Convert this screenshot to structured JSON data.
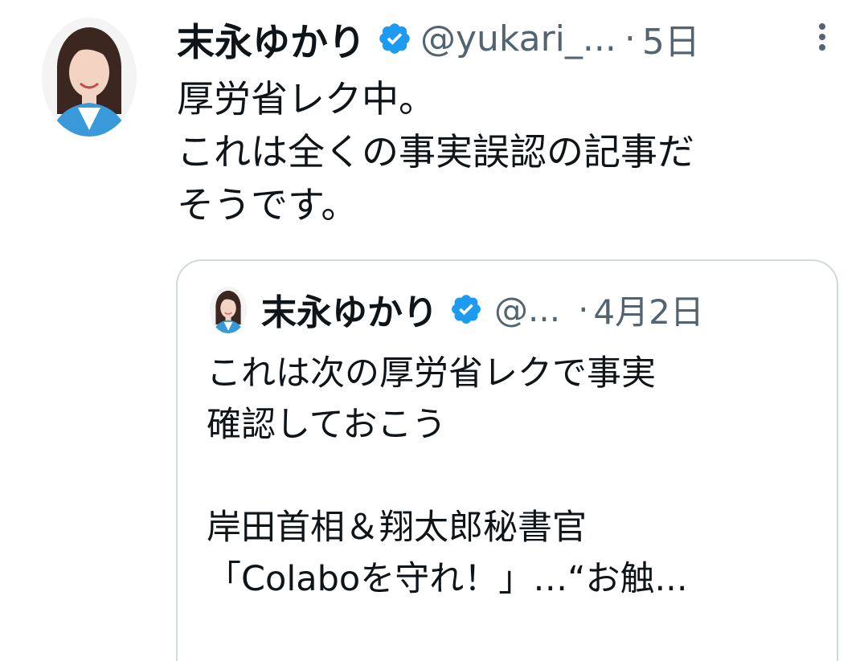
{
  "tweet": {
    "author_name": "末永ゆかり",
    "handle": "@yukari_...",
    "separator": "·",
    "time": "5日",
    "body_lines": [
      "厚労省レク中。",
      "これは全くの事実誤認の記事だ",
      "そうです。"
    ],
    "avatar_icon": "profile-photo",
    "verified_icon": "verified-badge-icon",
    "more_icon": "more-vertical-icon"
  },
  "quoted_tweet": {
    "author_name": "末永ゆかり",
    "handle": "@...",
    "separator": "·",
    "time": "4月2日",
    "body_lines": [
      "これは次の厚労省レクで事実",
      "確認しておこう",
      "",
      "岸田首相＆翔太郎秘書官",
      "「Colaboを守れ！」…“お触..."
    ]
  },
  "colors": {
    "verified": "#1d9bf0",
    "text_primary": "#0f1419",
    "text_secondary": "#536471",
    "border": "#cfd9de"
  }
}
